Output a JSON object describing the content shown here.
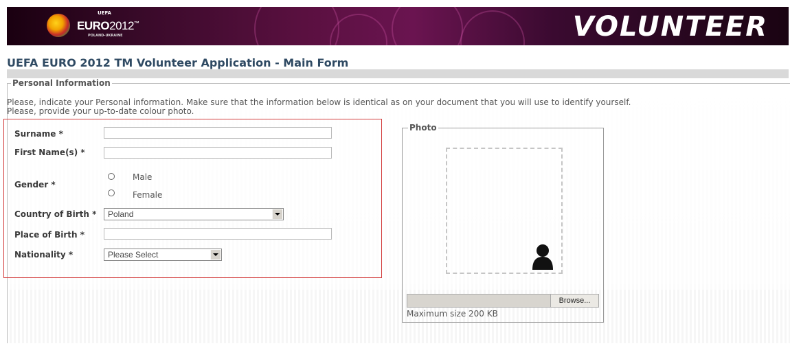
{
  "banner": {
    "logo_uefa": "UEFA",
    "logo_name_bold": "EURO",
    "logo_name_year": "2012",
    "logo_tm": "™",
    "logo_hosts": "POLAND-UKRAINE",
    "volunteer_text": "VOLUNTEER"
  },
  "page_title": "UEFA EURO 2012 TM Volunteer Application - Main Form",
  "section": {
    "legend": "Personal Information",
    "intro_line1": "Please, indicate your Personal information. Make sure that the information below is identical as on your document that you will use to identify yourself.",
    "intro_line2": "Please, provide your up-to-date colour photo."
  },
  "form": {
    "surname_label": "Surname *",
    "surname_value": "",
    "first_name_label": "First Name(s) *",
    "first_name_value": "",
    "gender_label": "Gender *",
    "gender_options": [
      "Male",
      "Female"
    ],
    "country_label": "Country of Birth *",
    "country_value": "Poland",
    "place_label": "Place of Birth *",
    "place_value": "",
    "nationality_label": "Nationality *",
    "nationality_value": "Please Select"
  },
  "photo": {
    "legend": "Photo",
    "browse_label": "Browse...",
    "max_size": "Maximum size 200 KB"
  },
  "colors": {
    "title": "#2f4a63",
    "highlight_border": "#d23b3b",
    "banner_dark": "#1a0010",
    "banner_mid": "#6a1450"
  },
  "icons": {
    "logo": "euro2012-logo",
    "photo_placeholder": "person-silhouette-icon",
    "dropdown": "chevron-down-icon"
  }
}
